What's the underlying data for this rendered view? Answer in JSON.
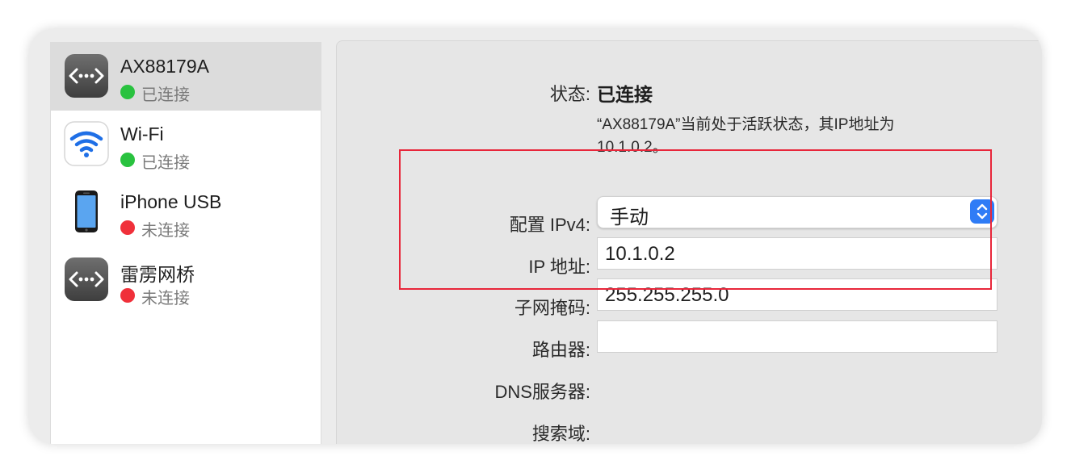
{
  "sidebar": {
    "items": [
      {
        "name": "AX88179A",
        "status": "已连接",
        "status_color": "#29c23f",
        "icon": "ethernet-icon",
        "selected": true
      },
      {
        "name": "Wi-Fi",
        "status": "已连接",
        "status_color": "#29c23f",
        "icon": "wifi-icon",
        "selected": false
      },
      {
        "name": "iPhone USB",
        "status": "未连接",
        "status_color": "#f0303a",
        "icon": "iphone-icon",
        "selected": false
      },
      {
        "name": "雷雳网桥",
        "status": "未连接",
        "status_color": "#f0303a",
        "icon": "ethernet-icon",
        "selected": false
      }
    ]
  },
  "detail": {
    "status_label": "状态:",
    "status_value": "已连接",
    "status_description_line1": "“AX88179A”当前处于活跃状态，其IP地址为",
    "status_description_line2": "10.1.0.2。",
    "configure_ipv4_label": "配置 IPv4:",
    "configure_ipv4_value": "手动",
    "ip_address_label": "IP 地址:",
    "ip_address_value": "10.1.0.2",
    "subnet_mask_label": "子网掩码:",
    "subnet_mask_value": "255.255.255.0",
    "router_label": "路由器:",
    "router_value": "",
    "dns_label": "DNS服务器:",
    "search_domains_label": "搜索域:"
  },
  "colors": {
    "highlight_border": "#e8263a",
    "accent": "#2f7cf6",
    "connected": "#29c23f",
    "disconnected": "#f0303a"
  }
}
